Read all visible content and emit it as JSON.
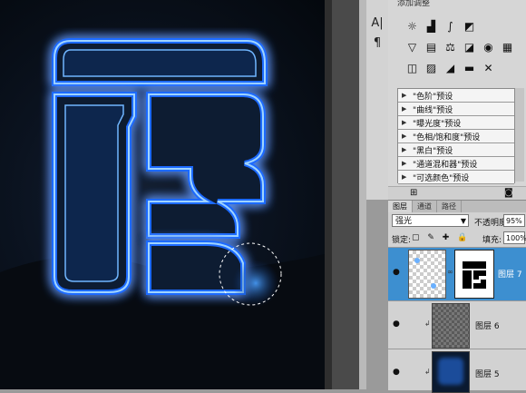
{
  "adjustments_panel": {
    "title": "添加调整",
    "presets": [
      "\"色阶\"预设",
      "\"曲线\"预设",
      "\"曝光度\"预设",
      "\"色相/饱和度\"预设",
      "\"黑白\"预设",
      "\"通道混和器\"预设",
      "\"可选颜色\"预设"
    ]
  },
  "layers_panel": {
    "tabs": [
      "图层",
      "通道",
      "路径"
    ],
    "blend_mode": "强光",
    "opacity_label": "不透明度:",
    "opacity_value": "95%",
    "lock_label": "锁定:",
    "fill_label": "填充:",
    "fill_value": "100%",
    "layers": [
      {
        "name": "图层 7",
        "selected": true
      },
      {
        "name": "图层 6",
        "selected": false
      },
      {
        "name": "图层 5",
        "selected": false
      }
    ]
  },
  "canvas": {
    "glow_color": "#1e6bff",
    "stroke_color": "#9fd4ff",
    "fill_color": "#0c1a33"
  },
  "icons": [
    "channels-icon",
    "brush-icon",
    "eye-icon",
    "link-icon",
    "layer-mask-icon",
    "delete-icon"
  ]
}
